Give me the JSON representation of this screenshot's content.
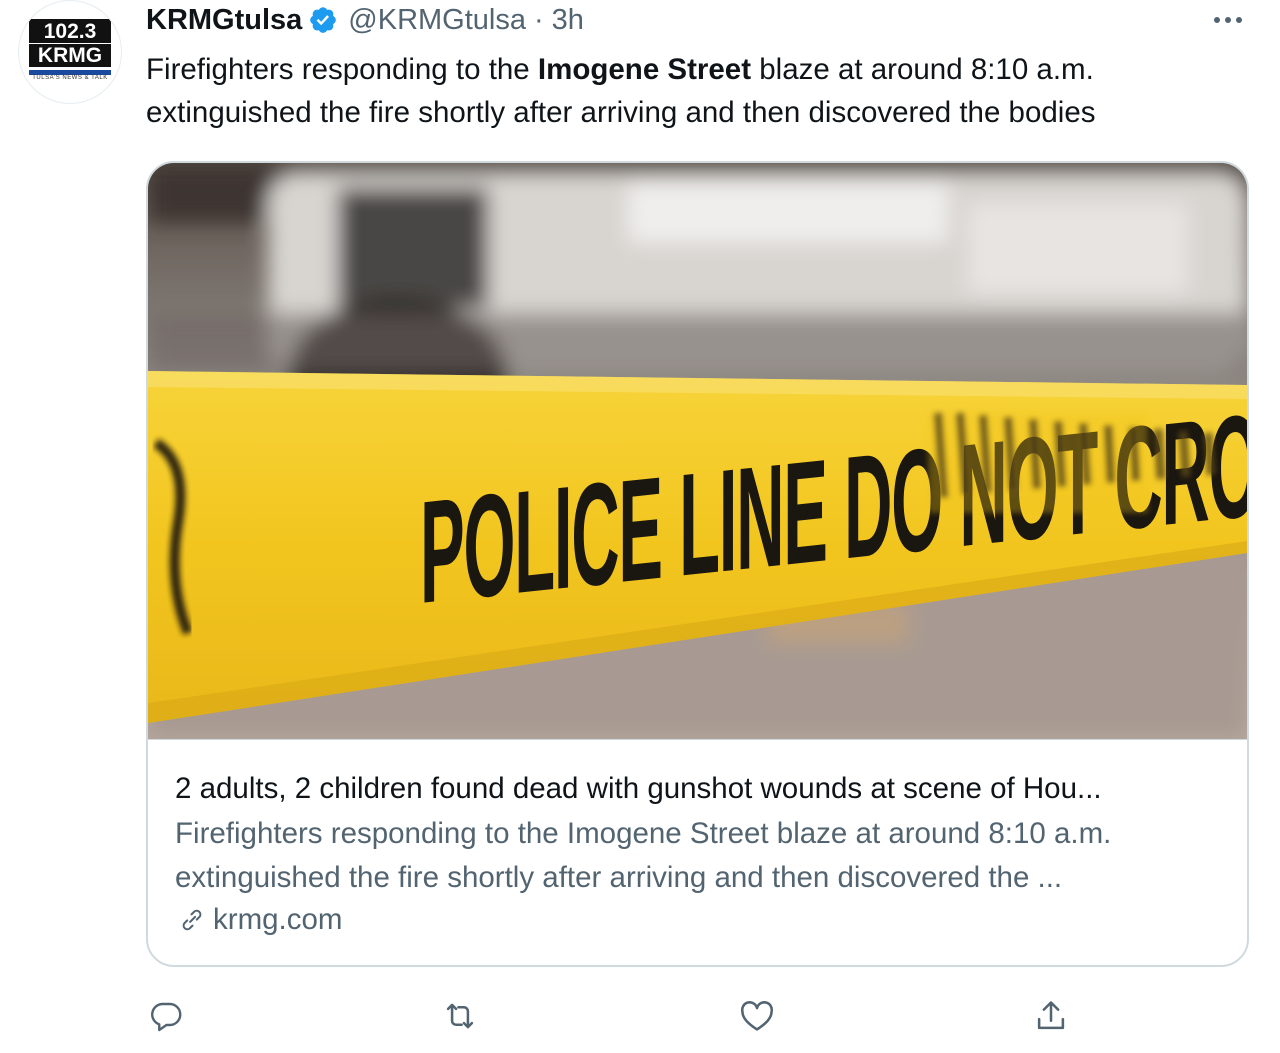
{
  "avatar": {
    "logo_top": "102.3",
    "logo_mid": "KRMG",
    "logo_sub": "TULSA'S NEWS & TALK"
  },
  "header": {
    "display_name": "KRMGtulsa",
    "verified_icon": "verified-badge-icon",
    "handle": "@KRMGtulsa",
    "separator": "·",
    "time": "3h",
    "more_icon": "more-options-icon"
  },
  "tweet": {
    "text_before": "Firefighters responding to the ",
    "text_bold": "Imogene Street",
    "text_after": " blaze at around 8:10 a.m. extinguished the fire shortly after arriving and then discovered the bodies"
  },
  "card": {
    "image_text": "POLICE LINE DO NOT CROSS",
    "title": "2 adults, 2 children found dead with gunshot wounds at scene of Hou...",
    "description": "Firefighters responding to the Imogene Street blaze at around 8:10 a.m. extinguished the fire shortly after arriving and then discovered the ...",
    "link_icon": "link-icon",
    "domain": "krmg.com"
  },
  "actions": [
    {
      "name": "reply-icon"
    },
    {
      "name": "retweet-icon"
    },
    {
      "name": "like-icon"
    },
    {
      "name": "share-icon"
    }
  ],
  "colors": {
    "text_primary": "#0f1419",
    "text_secondary": "#536471",
    "verified_blue": "#1d9bf0",
    "border": "#cfd9de",
    "tape_yellow": "#f2c51e"
  }
}
